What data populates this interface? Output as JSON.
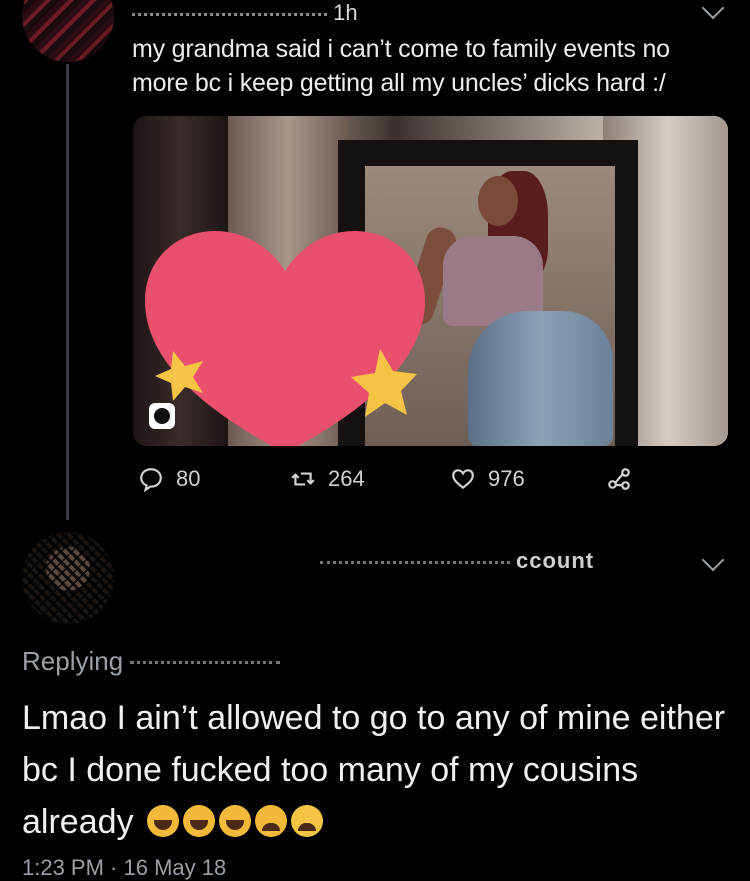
{
  "tweet": {
    "author_partial": "",
    "time": "1h",
    "text_line1": "my grandma said i can’t come to family events no",
    "text_line2": "more bc i keep getting all my uncles’ dicks hard :/",
    "stats": {
      "replies": "80",
      "retweets": "264",
      "likes": "976"
    }
  },
  "reply": {
    "name_partial": "ccount",
    "replying_label": "Replying",
    "text": "Lmao I ain’t allowed to go to any of mine either bc I done fucked too many of my cousins already",
    "timestamp": "1:23 PM · 16 May 18"
  },
  "colors": {
    "background": "#000000",
    "text": "#e8e8e8",
    "secondary": "#9aa0a6",
    "heart_sticker": "#e8506e",
    "star_sticker": "#f5c445"
  }
}
